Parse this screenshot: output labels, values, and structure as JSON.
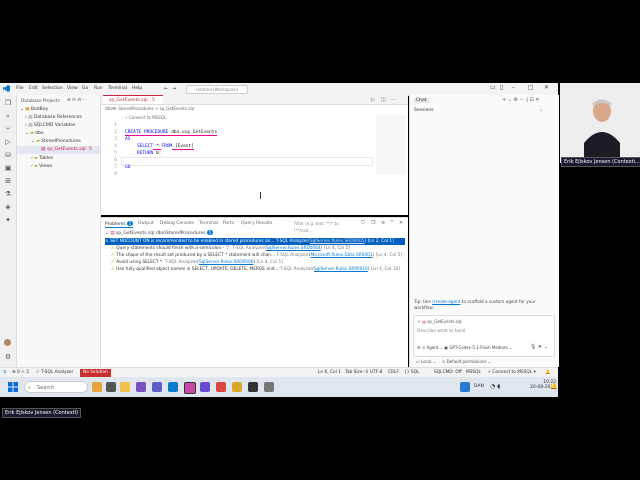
{
  "window": {
    "menu": [
      "File",
      "Edit",
      "Selection",
      "View",
      "Go",
      "Run",
      "Terminal",
      "Help"
    ],
    "search_placeholder": "Untitled (Workspace)"
  },
  "explorer": {
    "title": "Database Projects",
    "items": [
      {
        "label": "BadBoy"
      },
      {
        "label": "Database References"
      },
      {
        "label": "SQLCMD Variables"
      },
      {
        "label": "dbo"
      },
      {
        "label": "StoredProcedures"
      },
      {
        "label": "sp_GetEvents.sql",
        "badge": "5"
      },
      {
        "label": "Tables"
      },
      {
        "label": "Views"
      }
    ]
  },
  "editor": {
    "tab_label": "sp_GetEvents.sql",
    "tab_badge": "5",
    "breadcrumb": "dbo > StoredProcedures > sp_GetEvents.sql",
    "connect_label": "Connect to MSSQL",
    "line_numbers": [
      "1",
      "2",
      "3",
      "4",
      "5",
      "6",
      "7",
      "8"
    ],
    "code": {
      "l2_kw1": "CREATE PROCEDURE",
      "l2_obj": " dbo.usp_GetEvents",
      "l3_kw": "AS",
      "l4_kw1": "SELECT",
      "l4_mid": " * ",
      "l4_kw2": "FROM",
      "l4_obj": " [Event]",
      "l5_kw": "RETURN",
      "l5_val": " 0;",
      "l7_kw": "GO"
    }
  },
  "panel": {
    "tabs": [
      "Problems",
      "Output",
      "Debug Console",
      "Terminal",
      "Ports",
      "Query Results"
    ],
    "problems_count": "5",
    "filter_placeholder": "Filter (e.g. text, **/*.ts, !**/nod...",
    "file_label": "sp_GetEvents.sql dbo\\StoredProcedures",
    "file_badge": "5",
    "problems": [
      {
        "text": "SET NOCOUNT ON is recommended to be enabled in stored procedures an...",
        "source": "T-SQL Analyzer",
        "rule": "SqlServer.Rules.SRD0005",
        "pos": "[Ln 2, Col 1]",
        "selected": true
      },
      {
        "text": "Query statements should finish with a semicolon - ';'.",
        "source": "T-SQL Analyzer",
        "rule": "SqlServer.Rules.SRD0064",
        "pos": "[Ln 4, Col 5]",
        "selected": false
      },
      {
        "text": "The shape of the result set produced by a SELECT * statement will chan...",
        "source": "T-SQL Analyzer",
        "rule": "Microsoft.Rules.Data.SR0001",
        "pos": "[Ln 4, Col 5]",
        "selected": false
      },
      {
        "text": "Avoid using SELECT *.",
        "source": "T-SQL Analyzer",
        "rule": "SqlServer.Rules.SRD0006",
        "pos": "[Ln 4, Col 5]",
        "selected": false
      },
      {
        "text": "Use fully qualified object names in SELECT, UPDATE, DELETE, MERGE and...",
        "source": "T-SQL Analyzer",
        "rule": "SqlServer.Rules.SRP0016",
        "pos": "[Ln 4, Col 16]",
        "selected": false
      }
    ]
  },
  "chat": {
    "title": "Chat",
    "sessions": "Sessions",
    "tip_prefix": "Tip: Use ",
    "tip_link": "/create-agent",
    "tip_suffix": " to scaffold a custom agent for your workflow.",
    "context_file": "sp_GetEvents.sql",
    "input_placeholder": "Describe what to build",
    "agent_label": "Agent",
    "model_label": "GPT-Codex-5.1-Flash",
    "effort_label": "Medium",
    "local_label": "Local",
    "permissions_label": "Default permissions"
  },
  "statusbar": {
    "errors": "0",
    "warnings": "5",
    "analyzer": "T-SQL Analyzer",
    "no_solution": "No Solution",
    "position": "Ln 6, Col 1",
    "tab_size": "Tab Size: 4",
    "encoding": "UTF-8",
    "eol": "CRLF",
    "language": "SQL",
    "sqlcmd": "SQLCMD: Off",
    "mssql": "MSSQL",
    "connect": "Connect to MSSQL"
  },
  "taskbar": {
    "search": "Search",
    "lang": "DAN",
    "time": "10:22",
    "date": "20-08-2026"
  },
  "overlay": {
    "name_tag_right": "Erik Ejlskov Jensen (Contexti...",
    "name_tag_left": "Erik Ejlskov Jensen (ContextI)"
  }
}
